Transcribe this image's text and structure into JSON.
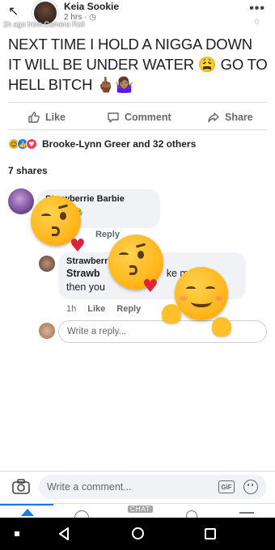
{
  "header": {
    "author": "Keia Sookie",
    "meta": "2 hrs · ",
    "camera_caption": "2h ago from Camera Roll",
    "notif_count": "0",
    "more": "•••"
  },
  "post": {
    "text_line1": "NEXT TIME I HOLD A NIGGA DOWN",
    "text_line2": "IT WILL BE UNDER WATER 😩 GO TO",
    "text_line3": "HELL BITCH 🖕🏾🤷🏽‍♀️"
  },
  "actions": {
    "like": "Like",
    "comment": "Comment",
    "share": "Share"
  },
  "reactions": {
    "summary": "Brooke-Lynn Greer and 32 others"
  },
  "shares": "7 shares",
  "comment": {
    "author": "Strawberrie Barbie",
    "text": "😂😂😂",
    "reply_label": "Reply"
  },
  "reply": {
    "author": "Strawberrie Barbie",
    "line1": "Strawb",
    "line1_end": "ke m",
    "line1_tail": "irst",
    "line2": "then you",
    "time": "1h",
    "like": "Like",
    "reply": "Reply"
  },
  "write_reply": {
    "placeholder": "Write a reply..."
  },
  "comment_bar": {
    "placeholder": "Write a comment...",
    "gif": "GIF"
  },
  "tabbar": {
    "chat": "CHAT"
  },
  "colors": {
    "accent": "#1877f2",
    "muted": "#65676b"
  }
}
